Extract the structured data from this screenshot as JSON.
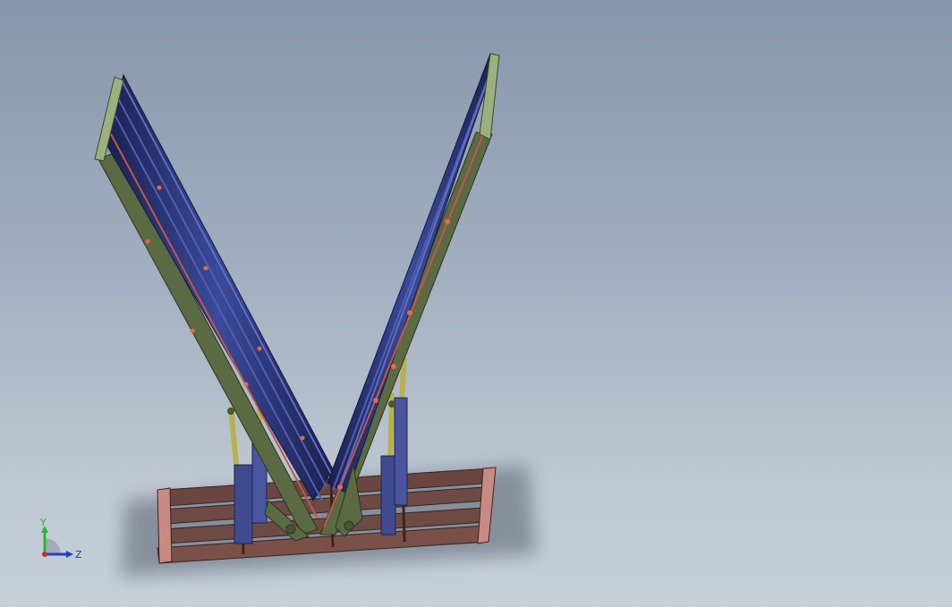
{
  "viewport": {
    "background_top": "#8797ab",
    "background_bottom": "#c7cfd8"
  },
  "model": {
    "frame_color": "#6e4a45",
    "panel_color": "#2e3a78",
    "bracket_color": "#5b6a43",
    "actuator_color": "#3f4a8f",
    "rod_color": "#b8b24a",
    "accent_color": "#e06a4a"
  },
  "triad": {
    "y_label": "Y",
    "z_label": "Z",
    "y_color": "#2bb33a",
    "z_color": "#1f3fd0"
  }
}
